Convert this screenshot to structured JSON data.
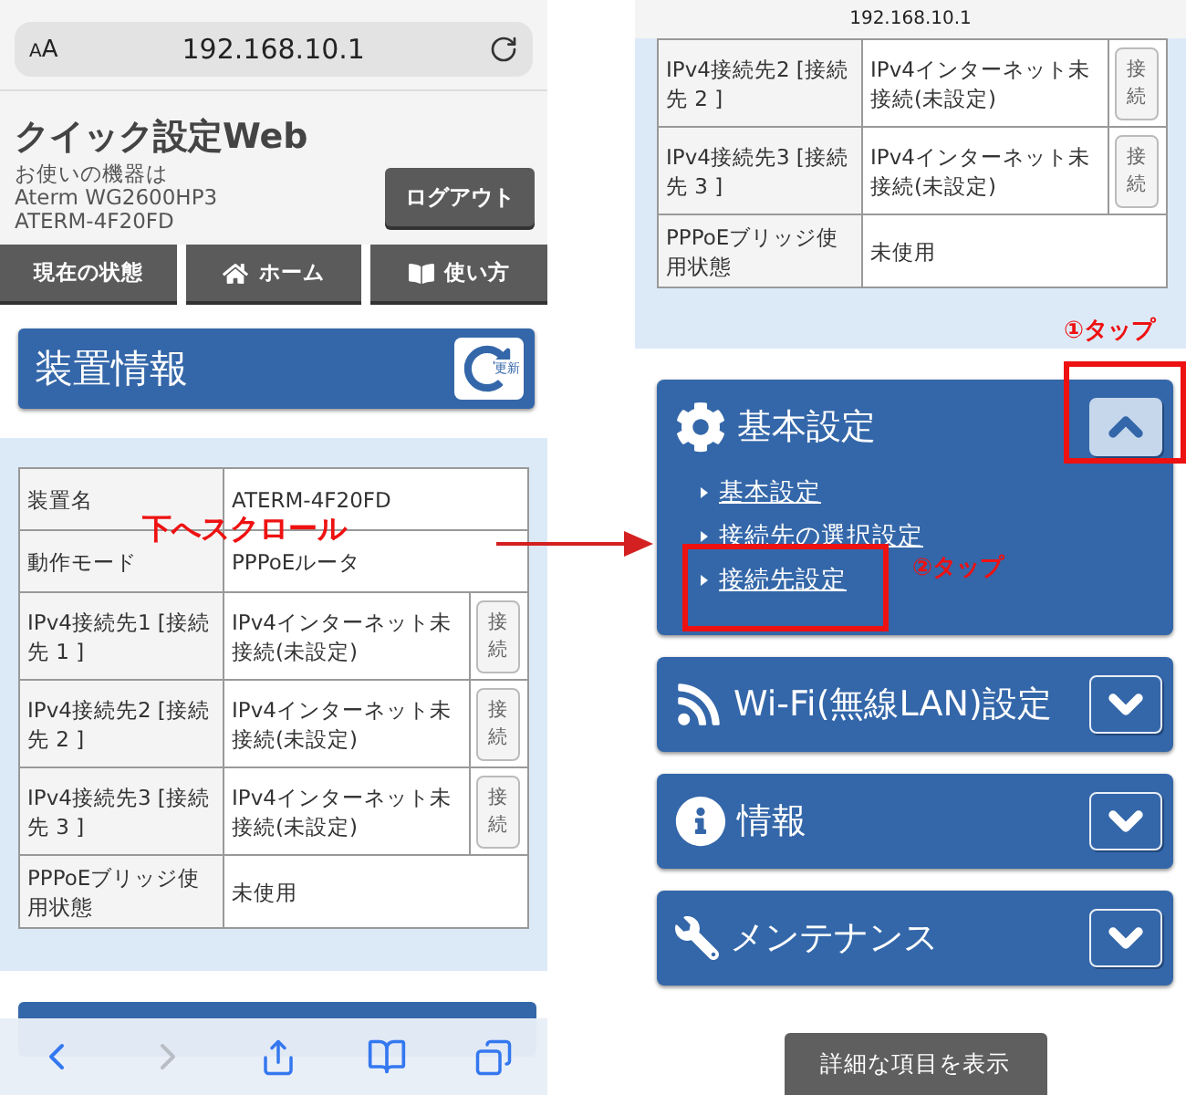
{
  "left_screen": {
    "browser_bar": {
      "text_size_button": "AA",
      "url": "192.168.10.1"
    },
    "header": {
      "title": "クイック設定Web",
      "device_lines": [
        "お使いの機器は",
        "Aterm WG2600HP3",
        "ATERM-4F20FD"
      ],
      "logout_button": "ログアウト"
    },
    "nav": [
      {
        "label": "現在の状態"
      },
      {
        "label": "ホーム"
      },
      {
        "label": "使い方"
      }
    ],
    "section": {
      "title": "装置情報",
      "refresh_button": "更新"
    },
    "table": {
      "callout": "下へスクロール",
      "rows": [
        {
          "label": "装置名",
          "value": "ATERM-4F20FD"
        },
        {
          "label": "動作モード",
          "value": "PPPoEルータ"
        },
        {
          "label": "IPv4接続先1 [接続先 1 ]",
          "value": "IPv4インターネット未接続(未設定)",
          "button": "接続"
        },
        {
          "label": "IPv4接続先2 [接続先 2 ]",
          "value": "IPv4インターネット未接続(未設定)",
          "button": "接続"
        },
        {
          "label": "IPv4接続先3 [接続先 3 ]",
          "value": "IPv4インターネット未接続(未設定)",
          "button": "接続"
        },
        {
          "label": "PPPoEブリッジ使用状態",
          "value": "未使用"
        }
      ]
    },
    "toolbar": {
      "forward_disabled": true
    }
  },
  "right_screen": {
    "url": "192.168.10.1",
    "table": {
      "rows": [
        {
          "label": "IPv4接続先2 [接続先 2 ]",
          "value": "IPv4インターネット未接続(未設定)",
          "button": "接続"
        },
        {
          "label": "IPv4接続先3 [接続先 3 ]",
          "value": "IPv4インターネット未接続(未設定)",
          "button": "接続"
        },
        {
          "label": "PPPoEブリッジ使用状態",
          "value": "未使用"
        }
      ]
    },
    "menus": [
      {
        "title": "基本設定",
        "expanded": true,
        "toggle_callout": "①タップ",
        "links": [
          {
            "label": "基本設定"
          },
          {
            "label": "接続先の選択設定"
          },
          {
            "label": "接続先設定",
            "callout": "②タップ"
          }
        ]
      },
      {
        "title": "Wi-Fi(無線LAN)設定",
        "expanded": false
      },
      {
        "title": "情報",
        "expanded": false
      },
      {
        "title": "メンテナンス",
        "expanded": false
      }
    ],
    "detail_button": "詳細な項目を表示"
  }
}
